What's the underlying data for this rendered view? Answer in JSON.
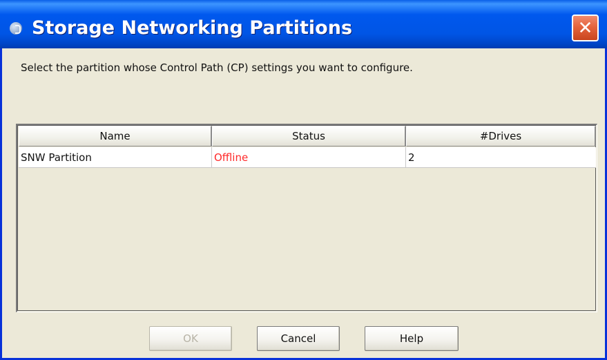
{
  "dialog": {
    "title": "Storage Networking Partitions",
    "close_symbol": "✕",
    "instruction": "Select the partition whose Control Path (CP) settings you want to configure."
  },
  "table": {
    "columns": [
      "Name",
      "Status",
      "#Drives"
    ],
    "rows": [
      {
        "name": "SNW Partition",
        "status": "Offline",
        "drives": "2"
      }
    ],
    "status_color": "#FF2A2A"
  },
  "buttons": {
    "ok": {
      "label": "OK",
      "enabled": false
    },
    "cancel": {
      "label": "Cancel",
      "enabled": true
    },
    "help": {
      "label": "Help",
      "enabled": true
    }
  },
  "icons": {
    "app": "app-icon",
    "close": "close-icon"
  },
  "colors": {
    "titlebar": "#0055E5",
    "close_button": "#E5643D",
    "dialog_background": "#ECE9D8"
  }
}
